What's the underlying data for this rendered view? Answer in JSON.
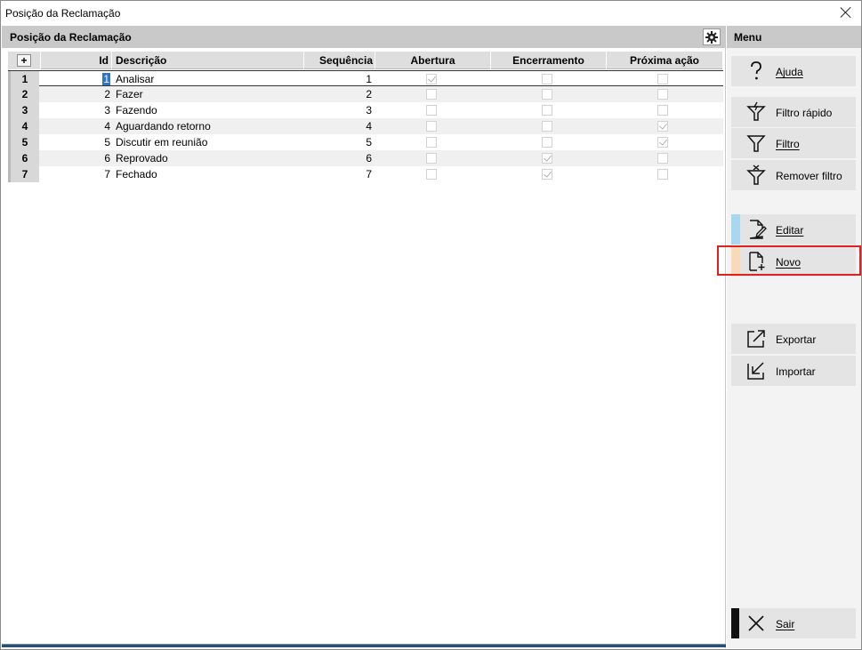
{
  "window": {
    "title": "Posição da Reclamação"
  },
  "main": {
    "header_title": "Posição da Reclamação"
  },
  "table": {
    "add_symbol": "+",
    "columns": {
      "id": "Id",
      "descricao": "Descrição",
      "sequencia": "Sequência",
      "abertura": "Abertura",
      "encerramento": "Encerramento",
      "proxima_acao": "Próxima ação"
    },
    "rows": [
      {
        "num": "1",
        "id": "1",
        "descricao": "Analisar",
        "sequencia": "1",
        "abertura": true,
        "encerramento": false,
        "proxima_acao": false
      },
      {
        "num": "2",
        "id": "2",
        "descricao": "Fazer",
        "sequencia": "2",
        "abertura": false,
        "encerramento": false,
        "proxima_acao": false
      },
      {
        "num": "3",
        "id": "3",
        "descricao": "Fazendo",
        "sequencia": "3",
        "abertura": false,
        "encerramento": false,
        "proxima_acao": false
      },
      {
        "num": "4",
        "id": "4",
        "descricao": "Aguardando retorno",
        "sequencia": "4",
        "abertura": false,
        "encerramento": false,
        "proxima_acao": true
      },
      {
        "num": "5",
        "id": "5",
        "descricao": "Discutir em reunião",
        "sequencia": "5",
        "abertura": false,
        "encerramento": false,
        "proxima_acao": true
      },
      {
        "num": "6",
        "id": "6",
        "descricao": "Reprovado",
        "sequencia": "6",
        "abertura": false,
        "encerramento": true,
        "proxima_acao": false
      },
      {
        "num": "7",
        "id": "7",
        "descricao": "Fechado",
        "sequencia": "7",
        "abertura": false,
        "encerramento": true,
        "proxima_acao": false
      }
    ]
  },
  "menu": {
    "title": "Menu",
    "items": {
      "ajuda": "Ajuda",
      "filtro_rapido": "Filtro rápido",
      "filtro": "Filtro",
      "remover_filtro": "Remover filtro",
      "editar": "Editar",
      "novo": "Novo",
      "exportar": "Exportar",
      "importar": "Importar",
      "sair": "Sair"
    }
  },
  "colors": {
    "header_gray": "#c9c9c9",
    "editar_accent": "#a8d8ef",
    "novo_accent": "#f8d9b8",
    "sair_accent": "#111111",
    "highlight_border": "#e02020",
    "selection_blue": "#3173c6"
  }
}
